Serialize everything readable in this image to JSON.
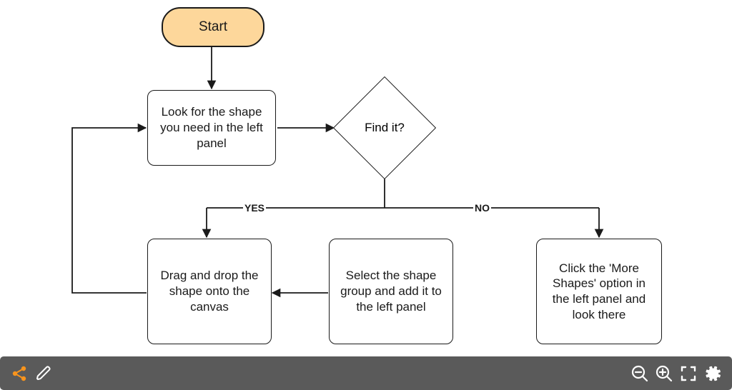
{
  "flow": {
    "start": "Start",
    "lookfor": "Look for the shape you need in the left panel",
    "decision": "Find it?",
    "yes_label": "YES",
    "no_label": "NO",
    "drag": "Drag and drop the shape onto the canvas",
    "select": "Select the shape group and add it to the left panel",
    "more": "Click the 'More Shapes' option in the left panel and look there"
  },
  "toolbar": {
    "share": "share-icon",
    "edit": "edit-icon",
    "zoom_out": "zoom-out-icon",
    "zoom_in": "zoom-in-icon",
    "fullscreen": "fullscreen-icon",
    "settings": "settings-icon"
  }
}
